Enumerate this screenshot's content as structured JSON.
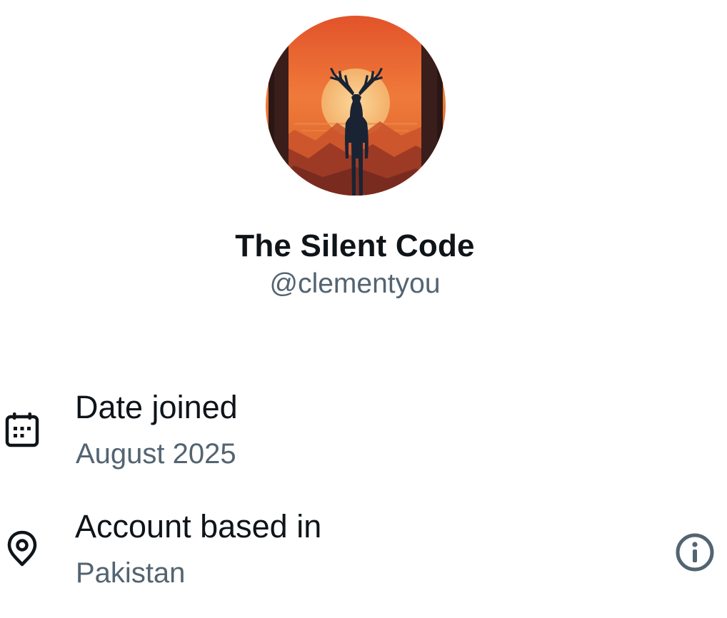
{
  "profile": {
    "display_name": "The Silent Code",
    "handle": "@clementyou",
    "avatar_icon": "deer-sunset-avatar"
  },
  "details": [
    {
      "label": "Date joined",
      "value": "August 2025",
      "icon": "calendar-icon"
    },
    {
      "label": "Account based in",
      "value": "Pakistan",
      "icon": "location-pin-icon",
      "action_icon": "info-icon"
    }
  ],
  "colors": {
    "primary_text": "#0f1419",
    "secondary_text": "#536471",
    "avatar_sky_top": "#e2532a",
    "avatar_sun": "#f6c07a",
    "avatar_silhouette": "#1a2333"
  }
}
